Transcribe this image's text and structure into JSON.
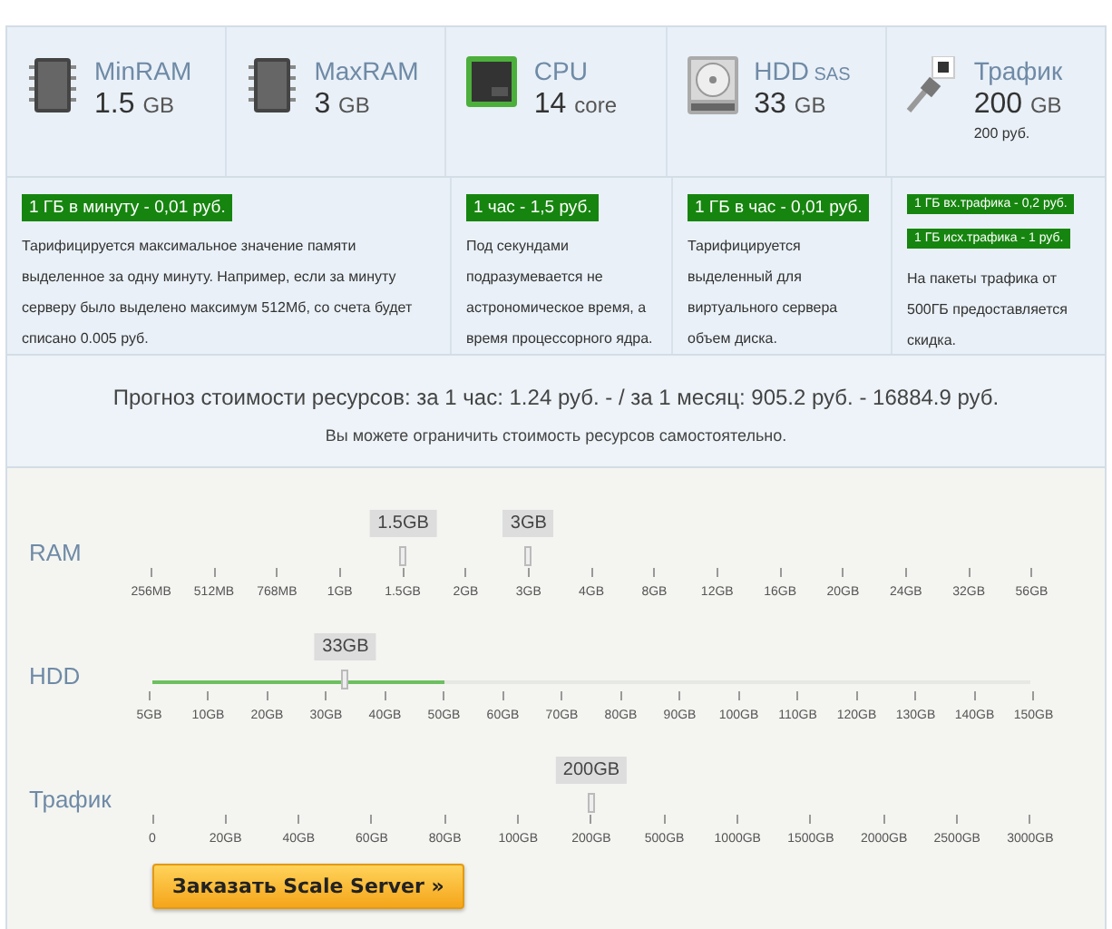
{
  "resources": [
    {
      "kind": "ram",
      "name": "MinRAM",
      "value": "1.5",
      "unit": "GB"
    },
    {
      "kind": "ram",
      "name": "MaxRAM",
      "value": "3",
      "unit": "GB"
    },
    {
      "kind": "cpu",
      "name": "CPU",
      "value": "14",
      "unit": "core"
    },
    {
      "kind": "hdd",
      "name": "HDD",
      "name_note": "SAS",
      "value": "33",
      "unit": "GB"
    },
    {
      "kind": "traffic",
      "name": "Трафик",
      "value": "200",
      "unit": "GB",
      "note": "200 руб."
    }
  ],
  "tariffs": [
    {
      "prices": [
        "1 ГБ в минуту - 0,01 руб."
      ],
      "description": "Тарифицируется максимальное значение памяти выделенное за одну минуту. Например, если за минуту серверу было выделено максимум 512Мб, со счета будет списано 0.005 руб."
    },
    {
      "prices": [
        "1 час - 1,5 руб."
      ],
      "description": "Под секундами подразумевается не астрономическое время, а время процессорного ядра."
    },
    {
      "prices": [
        "1 ГБ в час - 0,01 руб."
      ],
      "description": "Тарифицируется выделенный для виртуального сервера объем диска."
    },
    {
      "prices": [
        "1 ГБ вх.трафика - 0,2 руб.",
        "1 ГБ исх.трафика - 1 руб."
      ],
      "description": "На пакеты трафика от 500ГБ предоставляется скидка."
    }
  ],
  "forecast": {
    "text": "Прогноз стоимости ресурсов: за 1 час: 1.24 руб. - / за 1 месяц: 905.2 руб. - 16884.9 руб.",
    "note": "Вы можете ограничить стоимость ресурсов самостоятельно."
  },
  "sliders": [
    {
      "label": "RAM",
      "ticks": [
        "256MB",
        "512MB",
        "768MB",
        "1GB",
        "1.5GB",
        "2GB",
        "3GB",
        "4GB",
        "8GB",
        "12GB",
        "16GB",
        "20GB",
        "24GB",
        "32GB",
        "56GB"
      ],
      "handles": [
        {
          "bubble": "1.5GB",
          "level": 0.2857
        },
        {
          "bubble": "3GB",
          "level": 0.4286
        }
      ]
    },
    {
      "label": "HDD",
      "ticks": [
        "5GB",
        "10GB",
        "20GB",
        "30GB",
        "40GB",
        "50GB",
        "60GB",
        "70GB",
        "80GB",
        "90GB",
        "100GB",
        "110GB",
        "120GB",
        "130GB",
        "140GB",
        "150GB"
      ],
      "range": {
        "level": 0.3333
      },
      "handles": [
        {
          "bubble": "33GB",
          "level": 0.22
        }
      ]
    },
    {
      "label": "Трафик",
      "ticks": [
        "0",
        "20GB",
        "40GB",
        "60GB",
        "80GB",
        "100GB",
        "200GB",
        "500GB",
        "1000GB",
        "1500GB",
        "2000GB",
        "2500GB",
        "3000GB"
      ],
      "handles": [
        {
          "bubble": "200GB",
          "level": 0.5
        }
      ]
    }
  ],
  "order_button": "Заказать Scale Server »"
}
